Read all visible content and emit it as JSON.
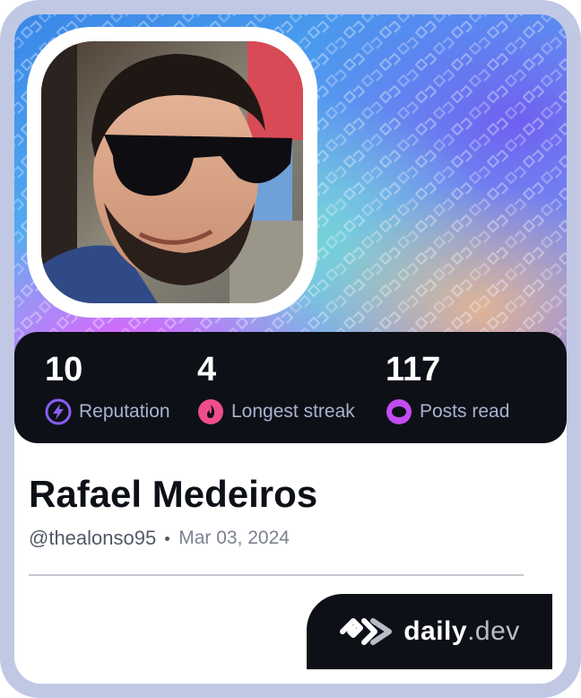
{
  "profile": {
    "name": "Rafael Medeiros",
    "handle": "@thealonso95",
    "date": "Mar 03, 2024"
  },
  "stats": [
    {
      "value": "10",
      "label": "Reputation",
      "icon": "lightning-icon",
      "color": "#8b5cf6"
    },
    {
      "value": "4",
      "label": "Longest streak",
      "icon": "flame-icon",
      "color": "#ef4e8a"
    },
    {
      "value": "117",
      "label": "Posts read",
      "icon": "eye-ring-icon",
      "color": "#c24cf0"
    }
  ],
  "brand": {
    "name": "daily",
    "tld": ".dev",
    "logo": "daily-dev-logo-icon"
  },
  "avatar": {
    "icon": "avatar-photo"
  },
  "colors": {
    "dark": "#0e1017",
    "label": "#a8b3cf",
    "frame": "#c0c8e4"
  }
}
